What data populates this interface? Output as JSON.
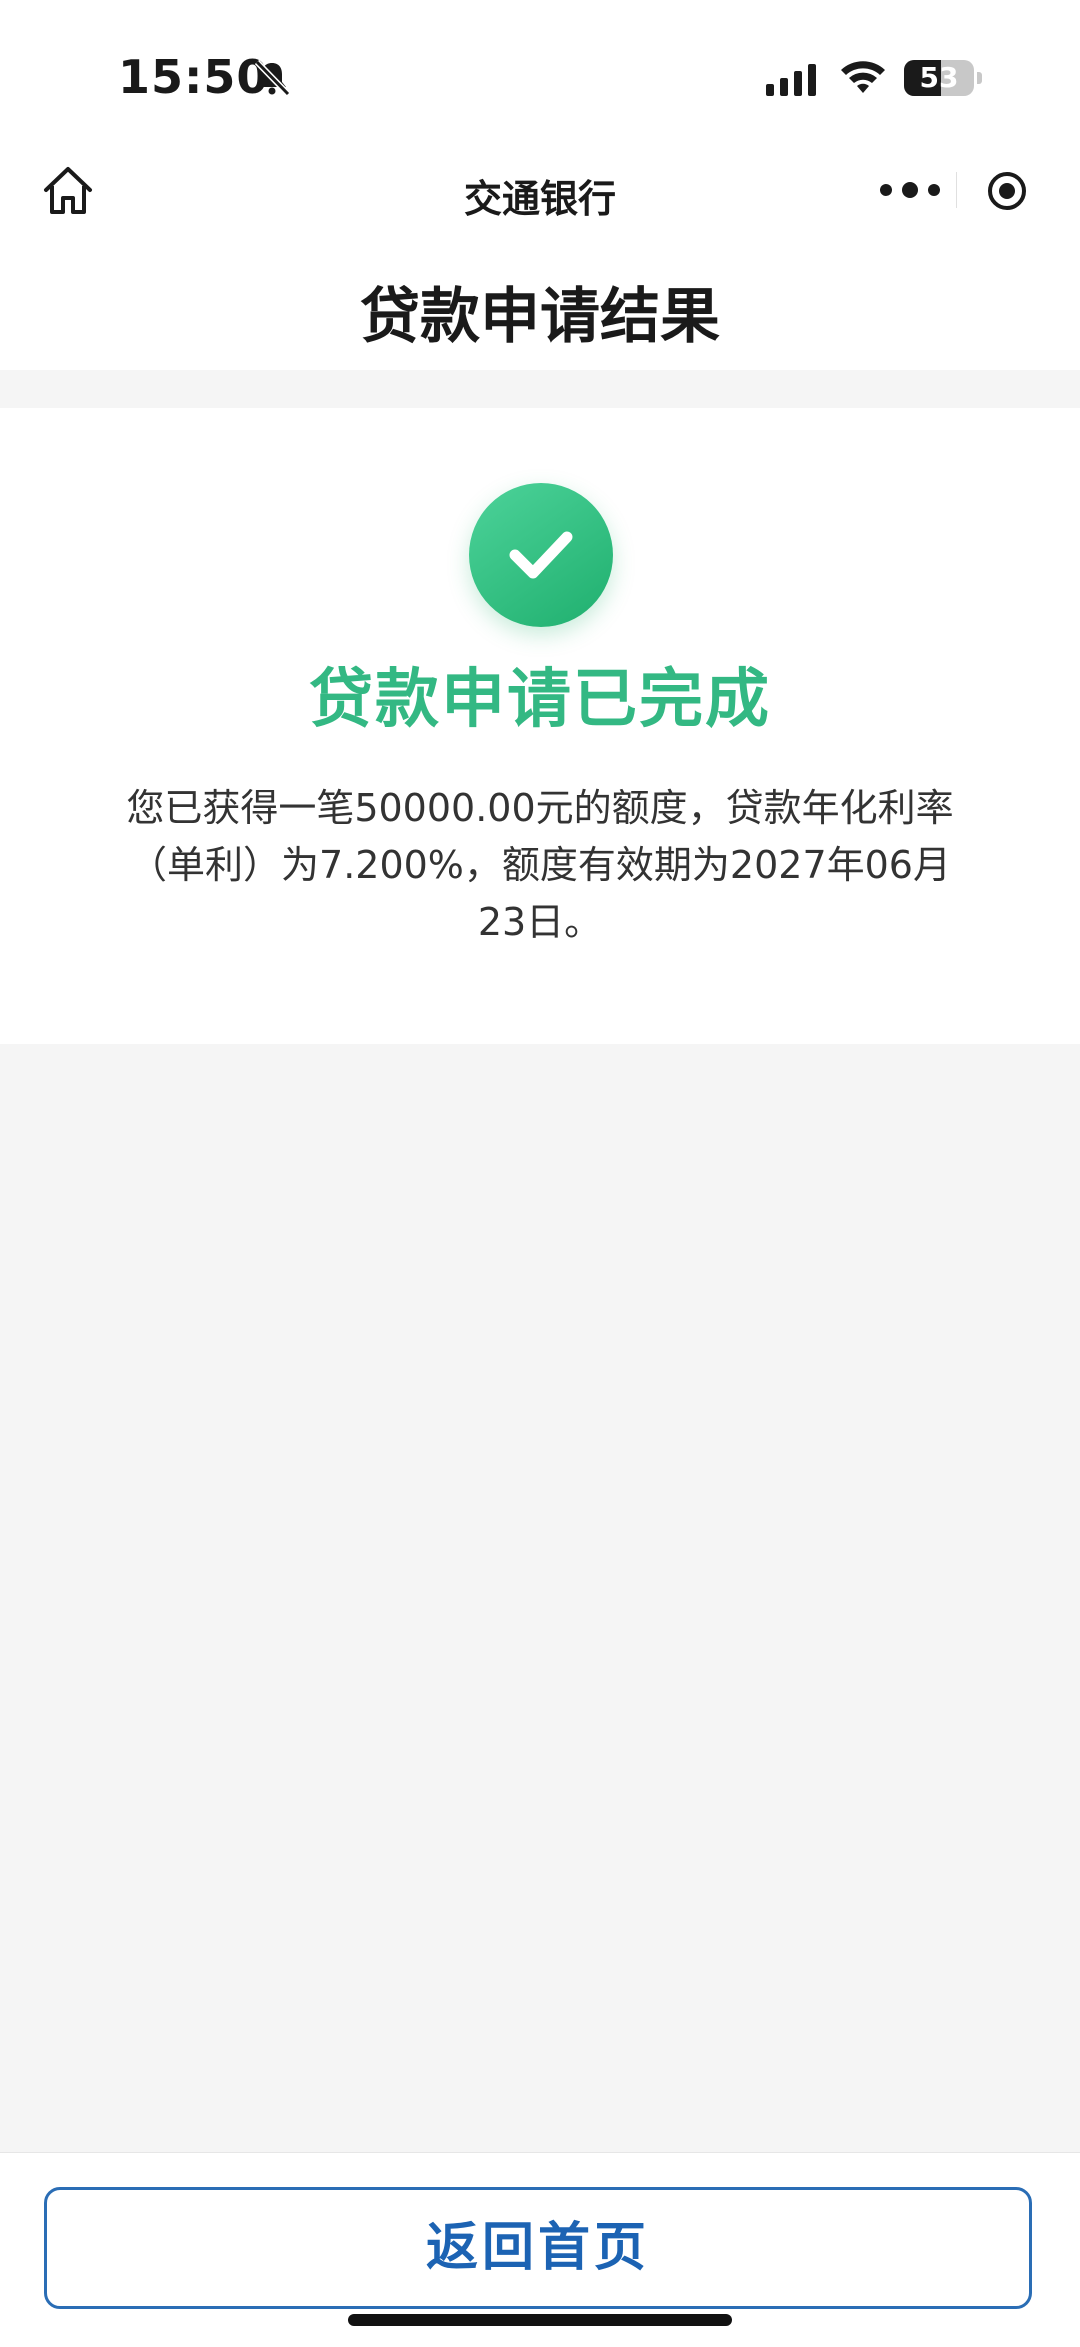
{
  "status_bar": {
    "time": "15:50",
    "battery_level": "53",
    "battery_percent": 53,
    "icons": [
      "bell-muted-icon",
      "signal-icon",
      "wifi-icon",
      "battery-icon"
    ]
  },
  "nav": {
    "title": "交通银行",
    "left_icon": "home-icon",
    "right_icons": [
      "more-icon",
      "target-icon"
    ]
  },
  "page": {
    "title": "贷款申请结果"
  },
  "result": {
    "icon": "success-check-icon",
    "title": "贷款申请已完成",
    "description": "您已获得一笔50000.00元的额度，贷款年化利率（单利）为7.200%，额度有效期为2027年06月23日。"
  },
  "footer": {
    "button_label": "返回首页"
  },
  "colors": {
    "success_green": "#33b883",
    "primary_blue": "#1c63b3",
    "background": "#f5f5f5"
  }
}
